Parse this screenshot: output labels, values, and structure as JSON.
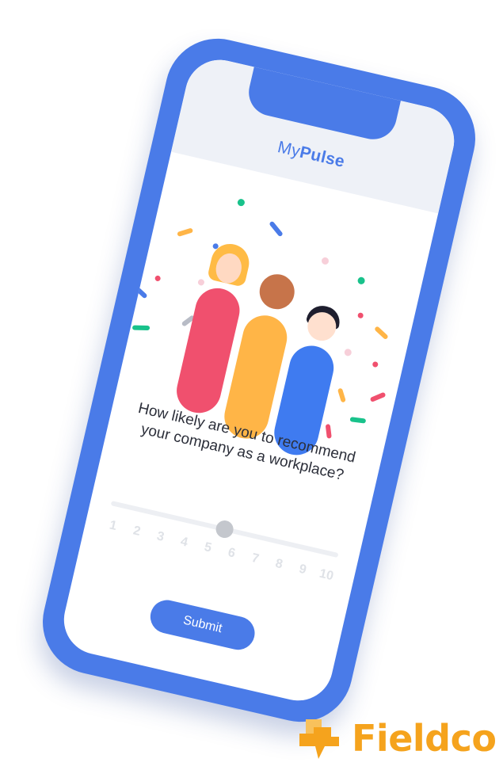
{
  "app": {
    "title_light": "My",
    "title_bold": "Pulse"
  },
  "survey": {
    "question": "How likely are you to recommend your company as a workplace?",
    "scale": [
      "1",
      "2",
      "3",
      "4",
      "5",
      "6",
      "7",
      "8",
      "9",
      "10"
    ],
    "selected_value": 5.5,
    "submit_label": "Submit"
  },
  "illustration": {
    "people": [
      {
        "name": "person-red",
        "body_color": "#f0506e",
        "skin": "#ffd9c2",
        "hair": "#ffbb45"
      },
      {
        "name": "person-yellow",
        "body_color": "#ffb547",
        "skin": "#c7744a",
        "hair": "#c7744a"
      },
      {
        "name": "person-blue",
        "body_color": "#3f7bf0",
        "skin": "#ffe0cf",
        "hair": "#1e1e2e"
      }
    ],
    "confetti_colors": [
      "#19c28b",
      "#4a7be8",
      "#f0506e",
      "#ffb547",
      "#f7cfd9",
      "#b8bcc6"
    ]
  },
  "brand": {
    "logo_text": "Fieldco",
    "accent": "#f5a31d",
    "phone_color": "#4a7be8"
  }
}
